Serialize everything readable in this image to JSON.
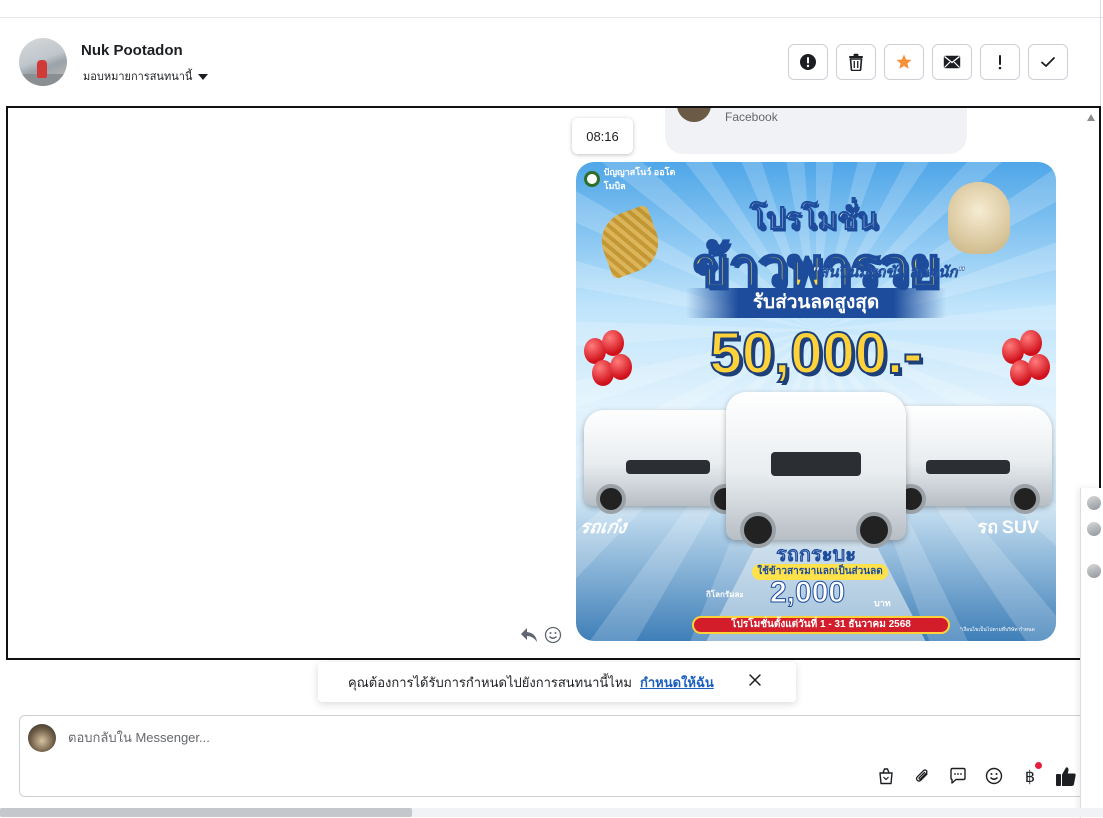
{
  "contact": {
    "name": "Nuk Pootadon",
    "assign_label": "มอบหมายการสนทนานี้"
  },
  "toolbar": {
    "buttons": [
      {
        "name": "spam-button",
        "icon": "alert-circle-icon"
      },
      {
        "name": "delete-button",
        "icon": "trash-icon"
      },
      {
        "name": "star-button",
        "icon": "star-icon",
        "color": "#f7923a"
      },
      {
        "name": "mark-unread-button",
        "icon": "envelope-icon"
      },
      {
        "name": "follow-up-button",
        "icon": "exclamation-icon"
      },
      {
        "name": "mark-done-button",
        "icon": "checkmark-icon"
      }
    ]
  },
  "chat": {
    "prev_message_source": "Facebook",
    "time_tooltip": "08:16"
  },
  "promo": {
    "brand": "ปัญญาสโนว์ ออโตโมบิล",
    "headline_small": "โปรโมชั่น",
    "headline_big": "ข้าวพารวย",
    "tagline": "\"สิ้นปีนี้มีรถขับ ลดหนัก\"",
    "discount_label": "รับส่วนลดสูงสุด",
    "discount_amount": "50,000.-",
    "label_left": "รถเก๋ง",
    "label_center": "รถกระบะ",
    "label_right": "รถ SUV",
    "rice_note": "ใช้ข้าวสารมาแลกเป็นส่วนลด",
    "per_kg": "กิโลกรัมละ",
    "price": "2,000",
    "baht": "บาท",
    "period": "โปรโมชั่นตั้งแต่วันที่ 1 - 31 ธันวาคม 2568",
    "fine_print": "*เงื่อนไขเป็นไปตามที่บริษัท กำหนด"
  },
  "assign_prompt": {
    "text": "คุณต้องการได้รับการกำหนดไปยังการสนทนานี้ไหม",
    "link": "กำหนดให้ฉัน"
  },
  "composer": {
    "placeholder": "ตอบกลับใน Messenger..."
  },
  "colors": {
    "link": "#1b5fc1",
    "star": "#f7923a",
    "border": "#ccd0d5"
  }
}
